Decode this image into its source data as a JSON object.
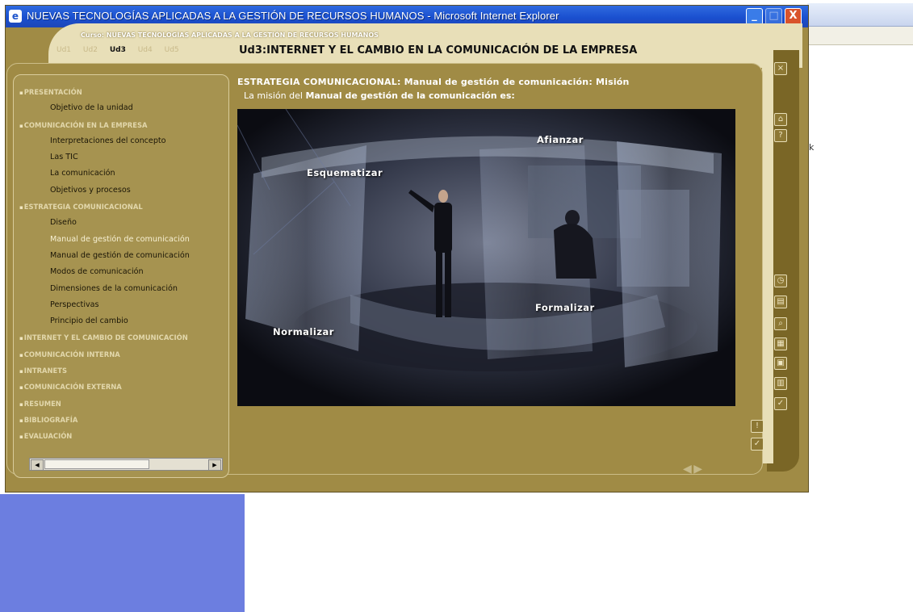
{
  "window": {
    "title": "NUEVAS TECNOLOGÍAS APLICADAS A LA GESTIÓN DE RECURSOS HUMANOS - Microsoft Internet Explorer",
    "minimize_glyph": "_",
    "maximize_glyph": "□",
    "close_glyph": "X"
  },
  "course": {
    "label_prefix": "Curso:",
    "label_value": "NUEVAS TECNOLOGÍAS APLICADAS A LA GESTIÓN DE RECURSOS HUMANOS"
  },
  "units": [
    "Ud1",
    "Ud2",
    "Ud3",
    "Ud4",
    "Ud5"
  ],
  "active_unit": "Ud3",
  "unit_title": "Ud3:INTERNET Y EL CAMBIO EN LA COMUNICACIÓN DE LA EMPRESA",
  "sidebar": {
    "items": [
      {
        "label": "PRESENTACIÓN",
        "type": "section"
      },
      {
        "label": "Objetivo de la unidad",
        "type": "sub"
      },
      {
        "label": "COMUNICACIÓN EN LA EMPRESA",
        "type": "section"
      },
      {
        "label": "Interpretaciones del concepto",
        "type": "sub"
      },
      {
        "label": "Las TIC",
        "type": "sub"
      },
      {
        "label": "La comunicación",
        "type": "sub"
      },
      {
        "label": "Objetivos y procesos",
        "type": "sub"
      },
      {
        "label": "ESTRATEGIA COMUNICACIONAL",
        "type": "section"
      },
      {
        "label": "Diseño",
        "type": "sub"
      },
      {
        "label": "Manual de gestión de comunicación",
        "type": "sub",
        "current": true
      },
      {
        "label": "Manual de gestión de comunicación",
        "type": "sub"
      },
      {
        "label": "Modos de comunicación",
        "type": "sub"
      },
      {
        "label": "Dimensiones de la comunicación",
        "type": "sub"
      },
      {
        "label": "Perspectivas",
        "type": "sub"
      },
      {
        "label": "Principio del cambio",
        "type": "sub"
      },
      {
        "label": "INTERNET Y EL CAMBIO DE COMUNICACIÓN",
        "type": "section"
      },
      {
        "label": "COMUNICACIÓN INTERNA",
        "type": "section"
      },
      {
        "label": "INTRANETS",
        "type": "section"
      },
      {
        "label": "COMUNICACIÓN EXTERNA",
        "type": "section"
      },
      {
        "label": "RESUMEN",
        "type": "section"
      },
      {
        "label": "BIBLIOGRAFÍA",
        "type": "section"
      },
      {
        "label": "EVALUACIÓN",
        "type": "section"
      }
    ]
  },
  "content": {
    "heading_bold": "ESTRATEGIA COMUNICACIONAL:",
    "heading_rest": " Manual de gestión de comunicación: Misión",
    "intro_prefix": "La misión del ",
    "intro_bold": "Manual de gestión de la comunicación es:",
    "image_labels": {
      "afianzar": "Afianzar",
      "esquematizar": "Esquematizar",
      "formalizar": "Formalizar",
      "normalizar": "Normalizar"
    }
  },
  "toolbar": {
    "close_glyph": "×",
    "home_glyph": "⌂",
    "help_glyph": "?",
    "check_glyph": "✓",
    "info_glyph": "!"
  },
  "nav": {
    "prev": "◀",
    "next": "▶"
  },
  "colors": {
    "titlebar": "#1a4fcf",
    "frame": "#a08b45",
    "accent": "#e8dfb8",
    "desktop_blue": "#6c7ee0"
  }
}
